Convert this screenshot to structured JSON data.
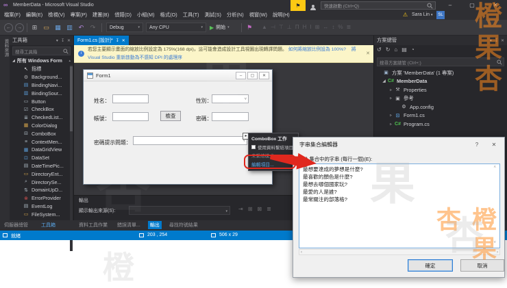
{
  "colors": {
    "accent_blue": "#007acc",
    "annotation_red": "#e0281e",
    "notification_bg": "#fbf5c8",
    "link_blue": "#3a7bd5",
    "watermark_orange": "#ff8a1e",
    "flag_yellow": "#fdc913"
  },
  "titlebar": {
    "title": "MemberData - Microsoft Visual Studio",
    "quick_launch_placeholder": "快速啟動 (Ctrl+Q)",
    "minimize_glyph": "–",
    "restore_glyph": "▢",
    "close_glyph": "✕",
    "flag_glyph": "⚑",
    "user_name": "Sara Lin",
    "user_caret": "▾",
    "user_initials": "SL",
    "warning_glyph": "⚠"
  },
  "menubar": {
    "items": [
      {
        "label": "檔案(F)"
      },
      {
        "label": "編輯(E)"
      },
      {
        "label": "檢視(V)"
      },
      {
        "label": "專案(P)"
      },
      {
        "label": "建置(B)"
      },
      {
        "label": "偵錯(D)"
      },
      {
        "label": "小組(M)"
      },
      {
        "label": "格式(O)"
      },
      {
        "label": "工具(T)"
      },
      {
        "label": "測試(S)"
      },
      {
        "label": "分析(N)"
      },
      {
        "label": "視窗(W)"
      },
      {
        "label": "說明(H)"
      }
    ]
  },
  "toolbar": {
    "nav_back_glyph": "←",
    "nav_forward_glyph": "→",
    "icons": [
      {
        "name": "new-project-icon",
        "glyph": "⊞",
        "color": "#b8b8bc"
      },
      {
        "name": "open-folder-icon",
        "glyph": "▭",
        "color": "#d8a85a"
      },
      {
        "name": "save-icon",
        "glyph": "▦",
        "color": "#6aa3e0"
      },
      {
        "name": "save-all-icon",
        "glyph": "▥",
        "color": "#6aa3e0"
      },
      {
        "name": "undo-icon",
        "glyph": "↶",
        "color": "#b085d6"
      },
      {
        "name": "redo-icon",
        "glyph": "↷",
        "color": "#6a6a6e"
      }
    ],
    "debug_label": "Debug",
    "platform_label": "Any CPU",
    "start_label": "開始",
    "start_play_glyph": "▶",
    "caret_glyph": "▾",
    "marker_glyph": "⚑",
    "layout_glyphs": [
      "▲",
      "⊣",
      "⊤",
      "⊥",
      "Π",
      "H",
      "I",
      "⊞",
      "↔",
      "↕",
      "%",
      "≣"
    ]
  },
  "left_strip": {
    "label": "資料來源"
  },
  "toolbox": {
    "title": "工具箱",
    "head_icons": [
      "▾",
      "↧",
      "✕"
    ],
    "search_placeholder": "搜尋工具箱",
    "category": "所有 Windows Form",
    "scroll_up_glyph": "▴",
    "items": [
      {
        "label": "指標",
        "glyph": "↖",
        "color": "#e8e8e8"
      },
      {
        "label": "Background...",
        "glyph": "⚙",
        "color": "#b0b0b4"
      },
      {
        "label": "BindingNavi...",
        "glyph": "▤",
        "color": "#5b9bd5"
      },
      {
        "label": "BindingSour...",
        "glyph": "▥",
        "color": "#5b9bd5"
      },
      {
        "label": "Button",
        "glyph": "▭",
        "color": "#a8b4bc"
      },
      {
        "label": "CheckBox",
        "glyph": "☑",
        "color": "#a8b4bc"
      },
      {
        "label": "CheckedList...",
        "glyph": "≣",
        "color": "#a8b4bc"
      },
      {
        "label": "ColorDialog",
        "glyph": "▦",
        "color": "#cfa04a"
      },
      {
        "label": "ComboBox",
        "glyph": "⊟",
        "color": "#a8b4bc"
      },
      {
        "label": "ContextMen...",
        "glyph": "≡",
        "color": "#a8b4bc"
      },
      {
        "label": "DataGridView",
        "glyph": "▦",
        "color": "#5b9bd5"
      },
      {
        "label": "DataSet",
        "glyph": "⊡",
        "color": "#5b9bd5"
      },
      {
        "label": "DateTimePic...",
        "glyph": "▤",
        "color": "#a8b4bc"
      },
      {
        "label": "DirectoryEnt...",
        "glyph": "▭",
        "color": "#cfa04a"
      },
      {
        "label": "DirectorySe...",
        "glyph": "⌕",
        "color": "#a8b4bc"
      },
      {
        "label": "DomainUpD...",
        "glyph": "⇅",
        "color": "#a8b4bc"
      },
      {
        "label": "ErrorProvider",
        "glyph": "⊗",
        "color": "#d05050"
      },
      {
        "label": "EventLog",
        "glyph": "▤",
        "color": "#a8b4bc"
      },
      {
        "label": "FileSystem...",
        "glyph": "▭",
        "color": "#cfa04a"
      }
    ]
  },
  "editor": {
    "tab_label": "Form1.cs [設計]*",
    "tab_pin_glyph": "↧",
    "tab_close_glyph": "✕",
    "notification": {
      "info_glyph": "i",
      "message": "若您主要顯示畫面的縮放比例設定為 175%(168 dpi)，這可能會造成設計工具視圖出現轉譯問題。",
      "link_scale": "如何將縮放比例設為 100%?",
      "link_restart": "將 Visual Studio 重新啟動為不感知 DPI 的處理序",
      "close_glyph": "✕"
    }
  },
  "designer_form": {
    "title": "Form1",
    "minimize_glyph": "–",
    "maximize_glyph": "▢",
    "close_glyph": "✕",
    "name_label": "姓名：",
    "gender_label": "性別：",
    "account_label": "帳號：",
    "password_label": "密碼：",
    "hint_label": "密碼提示問題：",
    "check_button": "檢查",
    "combo_arrow_glyph": "˅",
    "smart_tag_glyph": "▸"
  },
  "combo_popup": {
    "title": "ComboBox 工作",
    "use_data_binding": "使用資料繫結項目",
    "unbound_mode": "未繫結模式",
    "edit_items": "編輯項目..."
  },
  "dialog": {
    "title": "字串集合編輯器",
    "help_glyph": "?",
    "close_glyph": "✕",
    "label": "輸入集合中的字串 (每行一個)(E):",
    "lines": [
      {
        "text": "最想要達成的夢想是什麼?"
      },
      {
        "text": "最喜歡的顏色是什麼?"
      },
      {
        "text": "最想去哪個國家玩?"
      },
      {
        "text": "最愛的人是誰?"
      },
      {
        "text": "最常關注的部落格?"
      }
    ],
    "scroll_up_glyph": "˄",
    "scroll_down_glyph": "˅",
    "scroll_left_glyph": "‹",
    "scroll_right_glyph": "›",
    "ok_label": "確定",
    "cancel_label": "取消"
  },
  "output_panel": {
    "title": "輸出",
    "source_label": "顯示輸出來源(S):",
    "icons": [
      "⇥",
      "⊞",
      "⊠",
      "≣"
    ]
  },
  "bottom_tabs": {
    "left": [
      {
        "label": "伺服器總管"
      },
      {
        "label": "工具箱"
      }
    ],
    "center": [
      {
        "label": "資料工具作業"
      },
      {
        "label": "錯誤清單..."
      },
      {
        "label": "輸出"
      },
      {
        "label": "尋找符號結果"
      }
    ]
  },
  "solution_explorer": {
    "title": "方案總管",
    "head_icons": [
      "▾",
      "↧",
      "✕"
    ],
    "toolbar_icons": [
      {
        "name": "sol-back-icon",
        "glyph": "↺"
      },
      {
        "name": "sol-forward-icon",
        "glyph": "↻"
      },
      {
        "name": "sol-home-icon",
        "glyph": "⌂"
      },
      {
        "name": "sol-files-icon",
        "glyph": "▤"
      },
      {
        "name": "sol-pending-icon",
        "glyph": "◔"
      }
    ],
    "search_placeholder": "搜尋方案總管 (Ctrl+;)",
    "tree": [
      {
        "expander": "",
        "glyph": "▣",
        "glyph_color": "#9ab0c8",
        "label": "方案 'MemberData' (1 專案)",
        "weight": "normal",
        "pad": "3px"
      },
      {
        "expander": "◢",
        "glyph": "C#",
        "glyph_color": "#4ec04e",
        "label": "MemberData",
        "weight": "bold",
        "pad": "10px"
      },
      {
        "expander": "▹",
        "glyph": "⚒",
        "glyph_color": "#b8b8bc",
        "label": "Properties",
        "weight": "normal",
        "pad": "20px"
      },
      {
        "expander": "▹",
        "glyph": "▣",
        "glyph_color": "#b8b8bc",
        "label": "參考",
        "weight": "normal",
        "pad": "20px"
      },
      {
        "expander": "",
        "glyph": "⚙",
        "glyph_color": "#c8c8cc",
        "label": "App.config",
        "weight": "normal",
        "pad": "29px"
      },
      {
        "expander": "▹",
        "glyph": "⊡",
        "glyph_color": "#5b9bd5",
        "label": "Form1.cs",
        "weight": "normal",
        "pad": "20px"
      },
      {
        "expander": "▹",
        "glyph": "C#",
        "glyph_color": "#4ec04e",
        "label": "Program.cs",
        "weight": "normal",
        "pad": "20px"
      }
    ]
  },
  "status_bar": {
    "ready": "就緒",
    "position": "203 , 254",
    "size": "506 x 29"
  },
  "watermark": {
    "text": "橙果杏",
    "char1": "橙",
    "char2": "果",
    "char3": "杏"
  }
}
